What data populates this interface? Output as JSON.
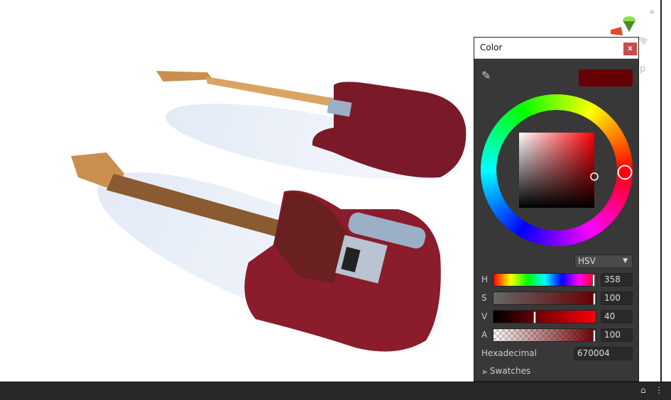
{
  "panel": {
    "title": "Color",
    "close_label": "x",
    "current_color": "#670004",
    "mode": "HSV",
    "channels": [
      {
        "label": "H",
        "value": "358",
        "fraction": 0.994
      },
      {
        "label": "S",
        "value": "100",
        "fraction": 1.0
      },
      {
        "label": "V",
        "value": "40",
        "fraction": 0.4
      },
      {
        "label": "A",
        "value": "100",
        "fraction": 1.0
      }
    ],
    "hex_label": "Hexadecimal",
    "hex_value": "670004",
    "swatches_label": "Swatches"
  },
  "scene": {
    "side_letter": "p"
  }
}
